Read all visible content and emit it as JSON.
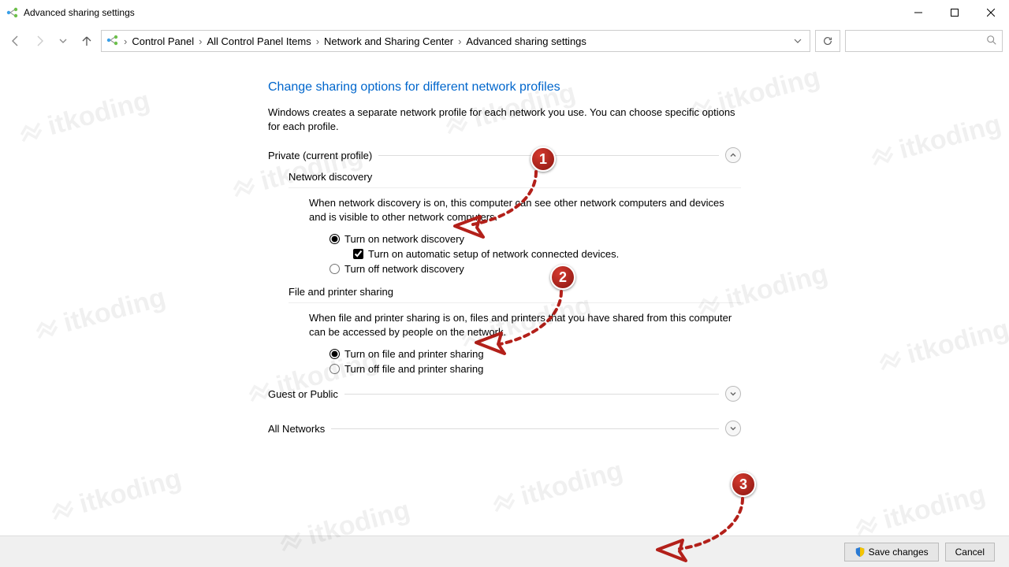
{
  "window": {
    "title": "Advanced sharing settings"
  },
  "breadcrumb": {
    "items": [
      "Control Panel",
      "All Control Panel Items",
      "Network and Sharing Center",
      "Advanced sharing settings"
    ]
  },
  "page": {
    "heading": "Change sharing options for different network profiles",
    "desc": "Windows creates a separate network profile for each network you use. You can choose specific options for each profile."
  },
  "profiles": {
    "private": {
      "label": "Private (current profile)",
      "sections": {
        "network_discovery": {
          "title": "Network discovery",
          "desc": "When network discovery is on, this computer can see other network computers and devices and is visible to other network computers.",
          "opt_on": "Turn on network discovery",
          "opt_auto": "Turn on automatic setup of network connected devices.",
          "opt_off": "Turn off network discovery"
        },
        "file_printer": {
          "title": "File and printer sharing",
          "desc": "When file and printer sharing is on, files and printers that you have shared from this computer can be accessed by people on the network.",
          "opt_on": "Turn on file and printer sharing",
          "opt_off": "Turn off file and printer sharing"
        }
      }
    },
    "guest": {
      "label": "Guest or Public"
    },
    "all": {
      "label": "All Networks"
    }
  },
  "buttons": {
    "save": "Save changes",
    "cancel": "Cancel"
  },
  "annotations": {
    "b1": "1",
    "b2": "2",
    "b3": "3"
  },
  "watermark": "itkoding"
}
